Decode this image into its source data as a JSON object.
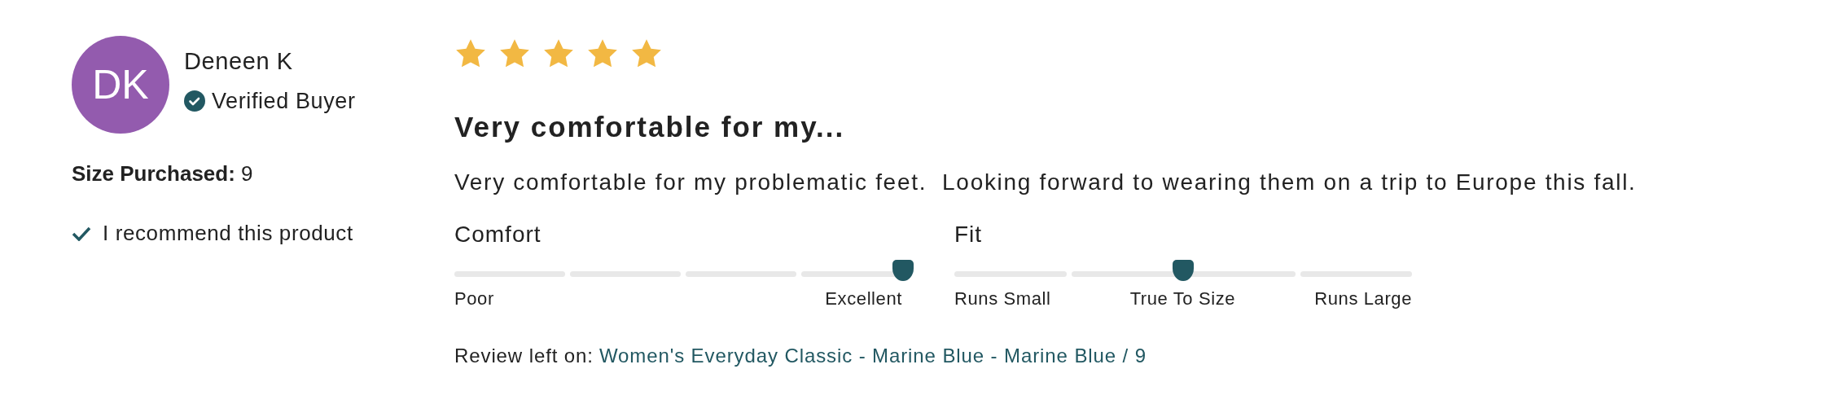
{
  "reviewer": {
    "initials": "DK",
    "name": "Deneen K",
    "badge": "Verified Buyer"
  },
  "size": {
    "label": "Size Purchased:",
    "value": "9"
  },
  "recommend": "I recommend this product",
  "review": {
    "stars": 5,
    "title": "Very comfortable for my...",
    "body": "Very comfortable for my problematic feet.  Looking forward to wearing them on a trip to Europe this fall."
  },
  "scales": [
    {
      "name": "Comfort",
      "level": 0.98,
      "labels": [
        "Poor",
        "Excellent"
      ]
    },
    {
      "name": "Fit",
      "level": 0.5,
      "labels": [
        "Runs Small",
        "True To Size",
        "Runs Large"
      ]
    }
  ],
  "review_left_on": {
    "label": "Review left on:",
    "link": "Women's Everyday Classic - Marine Blue - Marine Blue / 9"
  }
}
